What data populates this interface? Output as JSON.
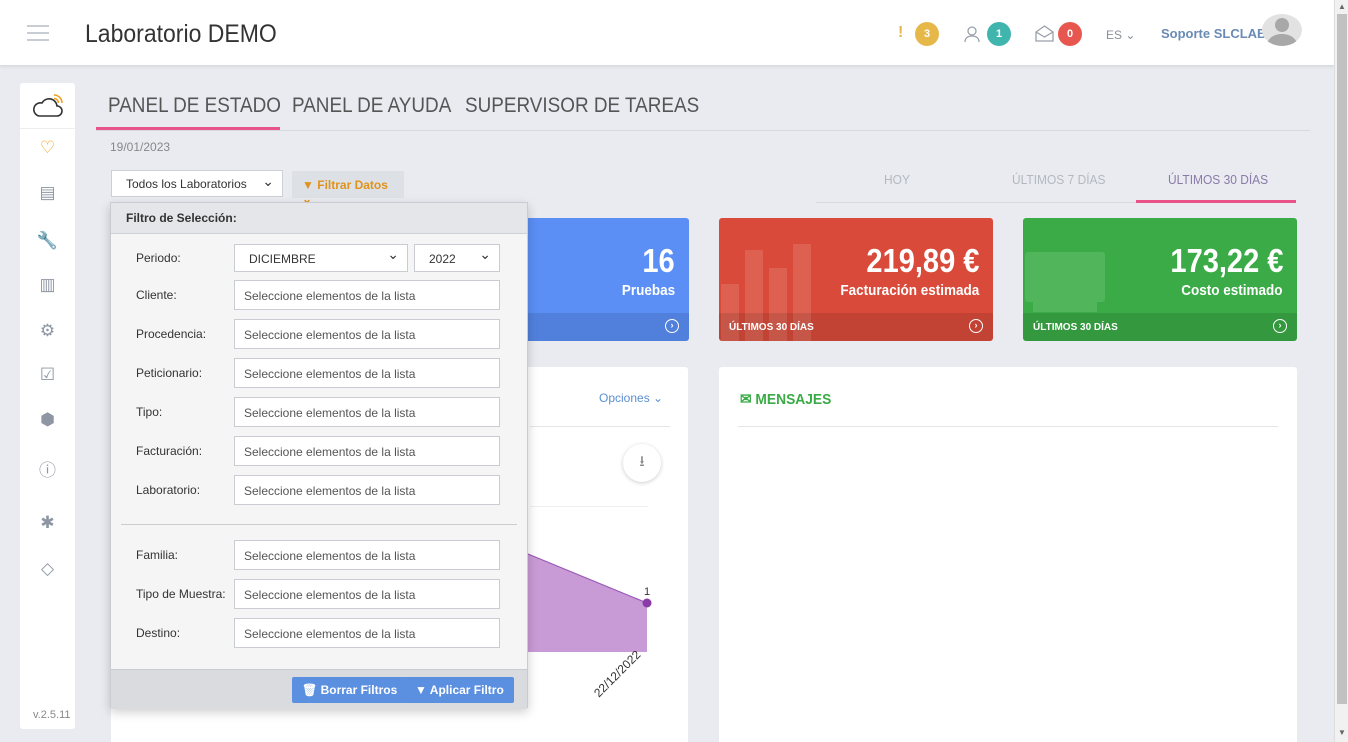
{
  "header": {
    "title": "Laboratorio DEMO",
    "alerts_count": "3",
    "users_count": "1",
    "mail_count": "0",
    "lang": "ES",
    "user_name": "Soporte SLCLAB",
    "colors": {
      "alerts": "#e6b84a",
      "users": "#3fb5ad",
      "mail": "#e8574f"
    }
  },
  "sidebar": {
    "version": "v.2.5.11"
  },
  "tabs": [
    "PANEL DE ESTADO",
    "PANEL DE AYUDA",
    "SUPERVISOR DE TAREAS"
  ],
  "date": "19/01/2023",
  "lab_select": "Todos los Laboratorios",
  "filter_button": "Filtrar Datos",
  "periods": [
    "HOY",
    "ÚLTIMOS 7 DÍAS",
    "ÚLTIMOS 30 DÍAS"
  ],
  "cards": [
    {
      "value": "16",
      "label": "Pruebas",
      "color": "#5b8ff5"
    },
    {
      "value": "219,89 €",
      "label": "Facturación estimada",
      "footer": "ÚLTIMOS 30 DÍAS",
      "color": "#d94a3a"
    },
    {
      "value": "173,22 €",
      "label": "Costo estimado",
      "footer": "ÚLTIMOS 30 DÍAS",
      "color": "#3aab46"
    }
  ],
  "chart_panel": {
    "options_label": "Opciones",
    "point_label": "1",
    "x_label": "22/12/2022"
  },
  "messages": {
    "title": "MENSAJES"
  },
  "filter": {
    "title": "Filtro de Selección:",
    "periodo_label": "Periodo:",
    "month": "DICIEMBRE",
    "year": "2022",
    "placeholder": "Seleccione elementos de la lista",
    "fields": [
      "Cliente:",
      "Procedencia:",
      "Peticionario:",
      "Tipo:",
      "Facturación:",
      "Laboratorio:"
    ],
    "fields2": [
      "Familia:",
      "Tipo de Muestra:",
      "Destino:"
    ],
    "clear_button": "Borrar Filtros",
    "apply_button": "Aplicar Filtro"
  }
}
